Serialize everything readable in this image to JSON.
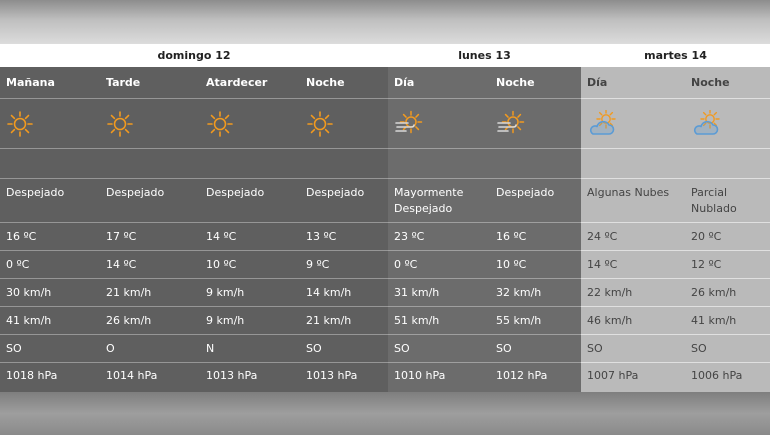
{
  "days": [
    {
      "label": "domingo 12"
    },
    {
      "label": "lunes 13"
    },
    {
      "label": "martes 14"
    }
  ],
  "columns": [
    {
      "period": "Mañana",
      "icon": "sun-icon",
      "condition": "Despejado",
      "temp_max": "16 ºC",
      "temp_min": "0 ºC",
      "wind": "30 km/h",
      "gust": "41 km/h",
      "direction": "SO",
      "pressure": "1018 hPa"
    },
    {
      "period": "Tarde",
      "icon": "sun-icon",
      "condition": "Despejado",
      "temp_max": "17 ºC",
      "temp_min": "14 ºC",
      "wind": "21 km/h",
      "gust": "26 km/h",
      "direction": "O",
      "pressure": "1014 hPa"
    },
    {
      "period": "Atardecer",
      "icon": "sun-icon",
      "condition": "Despejado",
      "temp_max": "14 ºC",
      "temp_min": "10 ºC",
      "wind": "9 km/h",
      "gust": "9 km/h",
      "direction": "N",
      "pressure": "1013 hPa"
    },
    {
      "period": "Noche",
      "icon": "sun-icon",
      "condition": "Despejado",
      "temp_max": "13 ºC",
      "temp_min": "9 ºC",
      "wind": "14 km/h",
      "gust": "21 km/h",
      "direction": "SO",
      "pressure": "1013 hPa"
    },
    {
      "period": "Día",
      "icon": "sun-wind-icon",
      "condition": "Mayormente Despejado",
      "temp_max": "23 ºC",
      "temp_min": "0 ºC",
      "wind": "31 km/h",
      "gust": "51 km/h",
      "direction": "SO",
      "pressure": "1010 hPa"
    },
    {
      "period": "Noche",
      "icon": "sun-wind-icon",
      "condition": "Despejado",
      "temp_max": "16 ºC",
      "temp_min": "10 ºC",
      "wind": "32 km/h",
      "gust": "55 km/h",
      "direction": "SO",
      "pressure": "1012 hPa"
    },
    {
      "period": "Día",
      "icon": "sun-cloud-icon",
      "condition": "Algunas Nubes",
      "temp_max": "24 ºC",
      "temp_min": "14 ºC",
      "wind": "22 km/h",
      "gust": "46 km/h",
      "direction": "SO",
      "pressure": "1007 hPa"
    },
    {
      "period": "Noche",
      "icon": "sun-cloud-icon",
      "condition": "Parcial Nublado",
      "temp_max": "20 ºC",
      "temp_min": "12 ºC",
      "wind": "26 km/h",
      "gust": "41 km/h",
      "direction": "SO",
      "pressure": "1006 hPa"
    }
  ],
  "colors": {
    "sun": "#f29a1f",
    "cloud": "#5b9bd5",
    "wind": "#d8d8d8"
  }
}
